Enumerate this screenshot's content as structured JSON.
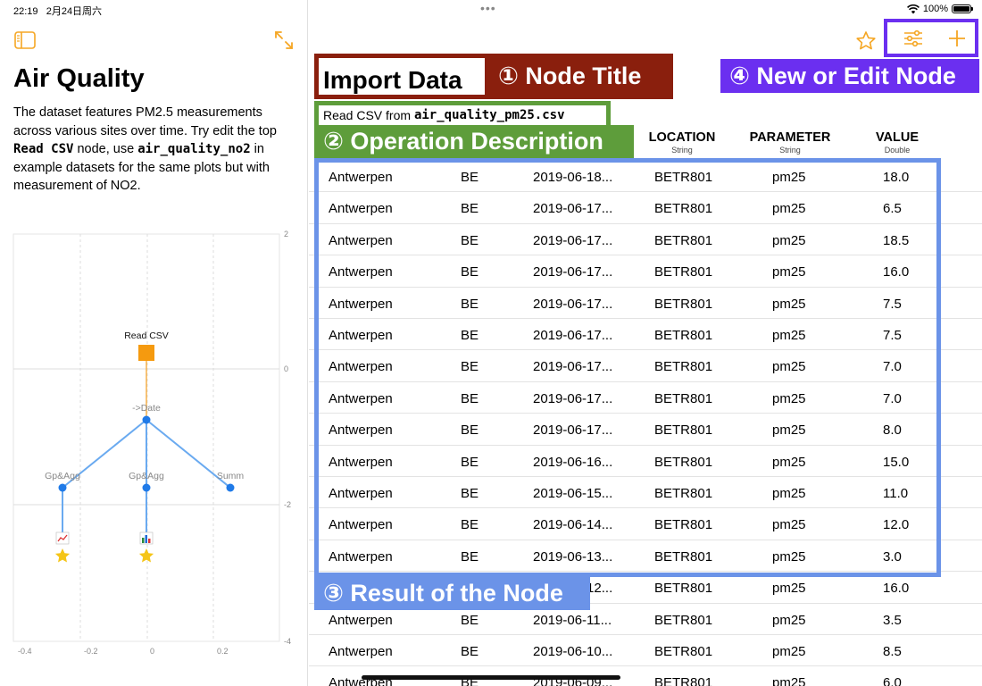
{
  "status": {
    "time": "22:19",
    "date": "2月24日周六",
    "dots": "•••",
    "battery": "100%",
    "battery_level": 0.98
  },
  "left": {
    "title": "Air Quality",
    "description": {
      "p1": "The dataset features PM2.5 measurements across various sites over time. Try edit the top ",
      "code1": "Read CSV",
      "p2": " node, use ",
      "code2": "air_quality_no2",
      "p3": " in example datasets for the same plots but with measurement of NO2."
    },
    "graph": {
      "y_ticks": [
        "2",
        "0",
        "-2",
        "-4"
      ],
      "x_ticks": [
        "-0.4",
        "-0.2",
        "0",
        "0.2"
      ],
      "nodes": {
        "read_csv": "Read CSV",
        "to_date": "->Date",
        "gp_agg_1": "Gp&Agg",
        "gp_agg_2": "Gp&Agg",
        "summ": "Summ"
      }
    }
  },
  "right": {
    "node_title": "Import Data",
    "operation": {
      "prefix": "Read CSV from ",
      "file": "air_quality_pm25.csv"
    },
    "labels": {
      "node_title": "① Node Title",
      "operation_description": "② Operation Description",
      "result": "③ Result of the Node",
      "new_edit": "④ New or Edit Node"
    },
    "columns": [
      {
        "name": "LOCATION",
        "type": "String"
      },
      {
        "name": "PARAMETER",
        "type": "String"
      },
      {
        "name": "VALUE",
        "type": "Double"
      }
    ],
    "rows": [
      [
        "Antwerpen",
        "BE",
        "2019-06-18...",
        "BETR801",
        "pm25",
        "18.0"
      ],
      [
        "Antwerpen",
        "BE",
        "2019-06-17...",
        "BETR801",
        "pm25",
        "6.5"
      ],
      [
        "Antwerpen",
        "BE",
        "2019-06-17...",
        "BETR801",
        "pm25",
        "18.5"
      ],
      [
        "Antwerpen",
        "BE",
        "2019-06-17...",
        "BETR801",
        "pm25",
        "16.0"
      ],
      [
        "Antwerpen",
        "BE",
        "2019-06-17...",
        "BETR801",
        "pm25",
        "7.5"
      ],
      [
        "Antwerpen",
        "BE",
        "2019-06-17...",
        "BETR801",
        "pm25",
        "7.5"
      ],
      [
        "Antwerpen",
        "BE",
        "2019-06-17...",
        "BETR801",
        "pm25",
        "7.0"
      ],
      [
        "Antwerpen",
        "BE",
        "2019-06-17...",
        "BETR801",
        "pm25",
        "7.0"
      ],
      [
        "Antwerpen",
        "BE",
        "2019-06-17...",
        "BETR801",
        "pm25",
        "8.0"
      ],
      [
        "Antwerpen",
        "BE",
        "2019-06-16...",
        "BETR801",
        "pm25",
        "15.0"
      ],
      [
        "Antwerpen",
        "BE",
        "2019-06-15...",
        "BETR801",
        "pm25",
        "11.0"
      ],
      [
        "Antwerpen",
        "BE",
        "2019-06-14...",
        "BETR801",
        "pm25",
        "12.0"
      ],
      [
        "Antwerpen",
        "BE",
        "2019-06-13...",
        "BETR801",
        "pm25",
        "3.0"
      ],
      [
        "Antwerpen",
        "BE",
        "2019-06-12...",
        "BETR801",
        "pm25",
        "16.0"
      ],
      [
        "Antwerpen",
        "BE",
        "2019-06-11...",
        "BETR801",
        "pm25",
        "3.5"
      ],
      [
        "Antwerpen",
        "BE",
        "2019-06-10...",
        "BETR801",
        "pm25",
        "8.5"
      ],
      [
        "Antwerpen",
        "BE",
        "2019-06-09...",
        "BETR801",
        "pm25",
        "6.0"
      ]
    ]
  },
  "icons": {
    "sidebar": "sidebar-icon",
    "expand": "expand-arrows-icon",
    "star": "star-outline-icon",
    "sliders": "sliders-icon",
    "plus": "plus-icon",
    "line_chart": "line-chart-icon",
    "bar_chart": "bar-chart-icon"
  },
  "colors": {
    "accent": "#f5a623",
    "node_blue": "#1f7ae8",
    "read_csv": "#f59a0f",
    "graph_line": "#6aaaf0",
    "star": "#f5c518",
    "node_title_label": "#8a1f0d",
    "op_label": "#5e9d3b",
    "result_label": "#6b93e8",
    "new_edit_label": "#6b2ff0"
  }
}
